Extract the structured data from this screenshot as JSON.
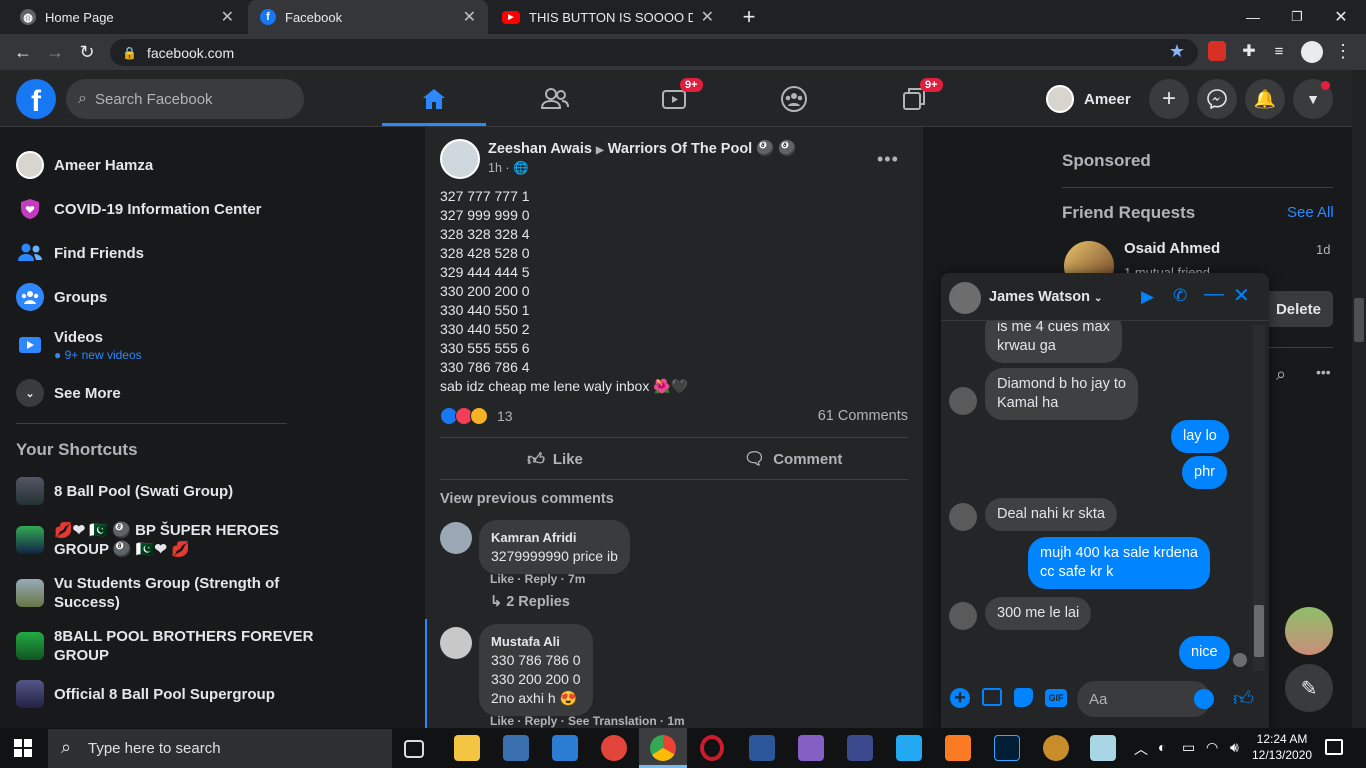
{
  "browser": {
    "tabs": [
      {
        "title": "Home Page",
        "active": false
      },
      {
        "title": "Facebook",
        "active": true
      },
      {
        "title": "THIS BUTTON IS SOOOO DANGE",
        "active": false
      }
    ],
    "url": "facebook.com"
  },
  "header": {
    "search_placeholder": "Search Facebook",
    "watch_badge": "9+",
    "gaming_badge": "9+",
    "profile_name": "Ameer"
  },
  "left_nav": {
    "items": [
      {
        "label": "Ameer Hamza"
      },
      {
        "label": "COVID-19 Information Center"
      },
      {
        "label": "Find Friends"
      },
      {
        "label": "Groups"
      },
      {
        "label": "Videos",
        "sub": "9+ new videos"
      },
      {
        "label": "See More"
      }
    ],
    "shortcuts_title": "Your Shortcuts",
    "shortcuts": [
      {
        "line1": "8 Ball Pool (Swati Group)",
        "line2": ""
      },
      {
        "line1": "💋❤ 🇵🇰 🎱 BP ŠUPER HEROES",
        "line2": "GROUP 🎱 🇵🇰❤ 💋"
      },
      {
        "line1": "Vu Students Group (Strength of",
        "line2": "Success)"
      },
      {
        "line1": "8BALL POOL BROTHERS FOREVER",
        "line2": "GROUP"
      },
      {
        "line1": "Official 8 Ball Pool Supergroup",
        "line2": ""
      }
    ]
  },
  "post": {
    "author": "Zeeshan Awais",
    "arrow": "▶",
    "group": "Warriors Of The Pool 🎱 🎱",
    "time": "1h · 🌐",
    "lines": [
      "327 777 777 1",
      "327 999 999 0",
      "328 328 328 4",
      "328 428 528 0",
      "329 444 444 5",
      "330 200 200 0",
      "330 440 550 1",
      "330 440 550 2",
      "330 555 555 6",
      "330 786 786 4",
      "sab idz cheap me lene waly inbox 🌺🖤"
    ],
    "reaction_count": "13",
    "comment_count": "61 Comments",
    "like_label": "Like",
    "comment_label": "Comment",
    "view_previous": "View previous comments",
    "comments": [
      {
        "name": "Kamran Afridi",
        "text": [
          "3279999990 price ib"
        ],
        "meta": "Like · Reply · 7m",
        "replies": "2 Replies"
      },
      {
        "name": "Mustafa Ali",
        "text": [
          "330 786 786 0",
          "330 200 200 0",
          "2no axhi h 😍"
        ],
        "meta": "Like · Reply · See Translation · 1m"
      }
    ]
  },
  "right": {
    "sponsored": "Sponsored",
    "friend_requests": "Friend Requests",
    "see_all": "See All",
    "request_name": "Osaid Ahmed",
    "request_time": "1d",
    "mutual": "1 mutual friend",
    "delete_label": "Delete"
  },
  "chat": {
    "name": "James Watson",
    "input_placeholder": "Aa",
    "messages": [
      {
        "dir": "in",
        "text": "is me 4 cues max\nkrwau ga"
      },
      {
        "dir": "in",
        "text": "Diamond b ho jay to\nKamal ha"
      },
      {
        "dir": "out",
        "text": "lay lo"
      },
      {
        "dir": "out",
        "text": "phr"
      },
      {
        "dir": "in",
        "text": "Deal nahi kr skta"
      },
      {
        "dir": "out",
        "text": "mujh 400 ka sale krdena\ncc safe kr k"
      },
      {
        "dir": "in",
        "text": "300 me le lai"
      },
      {
        "dir": "out",
        "text": "nice"
      }
    ]
  },
  "taskbar": {
    "search_placeholder": "Type here to search",
    "time": "12:24 AM",
    "date": "12/13/2020"
  },
  "colors": {
    "fb_blue": "#1877f2",
    "bg": "#18191a",
    "card": "#242526",
    "messenger_blue": "#0084ff"
  }
}
